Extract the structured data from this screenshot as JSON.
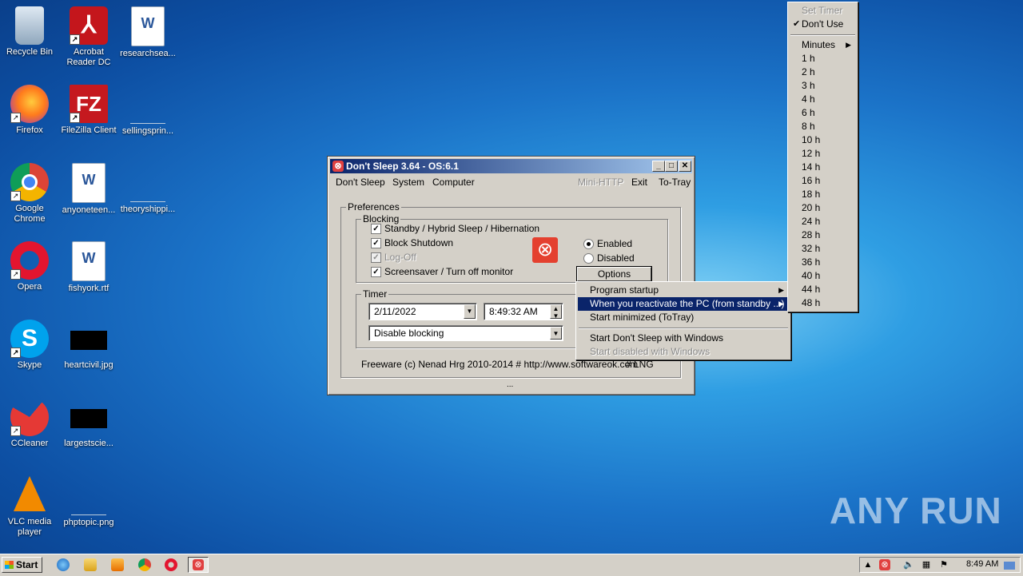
{
  "desktop": {
    "icons": [
      {
        "label": "Recycle Bin",
        "icon": "recycle-bin-icon"
      },
      {
        "label": "Acrobat Reader DC",
        "icon": "acrobat-icon"
      },
      {
        "label": "researchsea...",
        "icon": "word-doc-icon"
      },
      {
        "label": "Firefox",
        "icon": "firefox-icon"
      },
      {
        "label": "FileZilla Client",
        "icon": "filezilla-icon"
      },
      {
        "label": "sellingsprin...",
        "icon": "file-icon"
      },
      {
        "label": "Google Chrome",
        "icon": "chrome-icon"
      },
      {
        "label": "anyoneteen...",
        "icon": "word-doc-icon"
      },
      {
        "label": "theoryshippi...",
        "icon": "file-icon"
      },
      {
        "label": "Opera",
        "icon": "opera-icon"
      },
      {
        "label": "fishyork.rtf",
        "icon": "word-doc-icon"
      },
      {
        "label": "Skype",
        "icon": "skype-icon"
      },
      {
        "label": "heartcivil.jpg",
        "icon": "image-icon"
      },
      {
        "label": "CCleaner",
        "icon": "ccleaner-icon"
      },
      {
        "label": "largestscie...",
        "icon": "image-icon"
      },
      {
        "label": "VLC media player",
        "icon": "vlc-icon"
      },
      {
        "label": "phptopic.png",
        "icon": "image-icon"
      }
    ]
  },
  "window": {
    "title": "Don't Sleep 3.64 - OS:6.1",
    "controls": {
      "minimize": "_",
      "maximize": "□",
      "close": "✕"
    },
    "menu": [
      "Don't Sleep",
      "System",
      "Computer",
      "Mini-HTTP",
      "Exit",
      "To-Tray"
    ],
    "preferences_label": "Preferences",
    "blocking_label": "Blocking",
    "checks": [
      {
        "label": "Standby / Hybrid Sleep / Hibernation",
        "checked": true,
        "enabled": true
      },
      {
        "label": "Block Shutdown",
        "checked": true,
        "enabled": true
      },
      {
        "label": "Log-Off",
        "checked": true,
        "enabled": false
      },
      {
        "label": "Screensaver / Turn off monitor",
        "checked": true,
        "enabled": true
      }
    ],
    "radio_enabled": "Enabled",
    "radio_disabled": "Disabled",
    "options_button": "Options",
    "timer_label": "Timer",
    "date_value": "2/11/2022",
    "time_value": "8:49:32 AM",
    "mode_value": "Disable blocking",
    "footer": "Freeware (c) Nenad Hrg 2010-2014 # http://www.softwareok.com",
    "lng": "# LNG",
    "grip": "..."
  },
  "options_menu": {
    "items": [
      {
        "label": "Program startup",
        "submenu": true,
        "selected": false,
        "enabled": true
      },
      {
        "label": "When you reactivate the PC (from standby ...)",
        "submenu": true,
        "selected": true,
        "enabled": true
      },
      {
        "label": "Start minimized (ToTray)",
        "submenu": false,
        "selected": false,
        "enabled": true
      },
      {
        "label": "Start Don't Sleep with Windows",
        "submenu": false,
        "selected": false,
        "enabled": true
      },
      {
        "label": "Start disabled with Windows",
        "submenu": false,
        "selected": false,
        "enabled": false
      }
    ]
  },
  "timer_menu": {
    "set_timer": "Set Timer",
    "dont_use": "Don't Use",
    "minutes": "Minutes",
    "hours": [
      "1 h",
      "2 h",
      "3 h",
      "4 h",
      "6 h",
      "8 h",
      "10 h",
      "12 h",
      "14 h",
      "16 h",
      "18 h",
      "20 h",
      "24 h",
      "28 h",
      "32 h",
      "36 h",
      "40 h",
      "44 h",
      "48 h"
    ]
  },
  "taskbar": {
    "start": "Start",
    "clock": "8:49 AM"
  },
  "watermark": "ANY RUN",
  "colors": {
    "titlebar": "#0a246a",
    "menu_highlight": "#0a246a",
    "face": "#d4d0c8"
  }
}
